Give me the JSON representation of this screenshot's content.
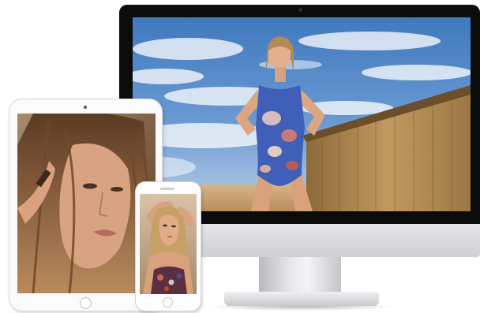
{
  "devices": {
    "desktop": {
      "icon": "desktop-monitor-icon"
    },
    "tablet": {
      "icon": "tablet-icon"
    },
    "phone": {
      "icon": "smartphone-icon"
    }
  },
  "colors": {
    "sky": "#5d8fc9",
    "swimsuit": "#3f5fb8",
    "wood": "#b18a52",
    "sand": "#d7b48a",
    "hair": "#7a5232",
    "frame": "#0b0b0b"
  }
}
